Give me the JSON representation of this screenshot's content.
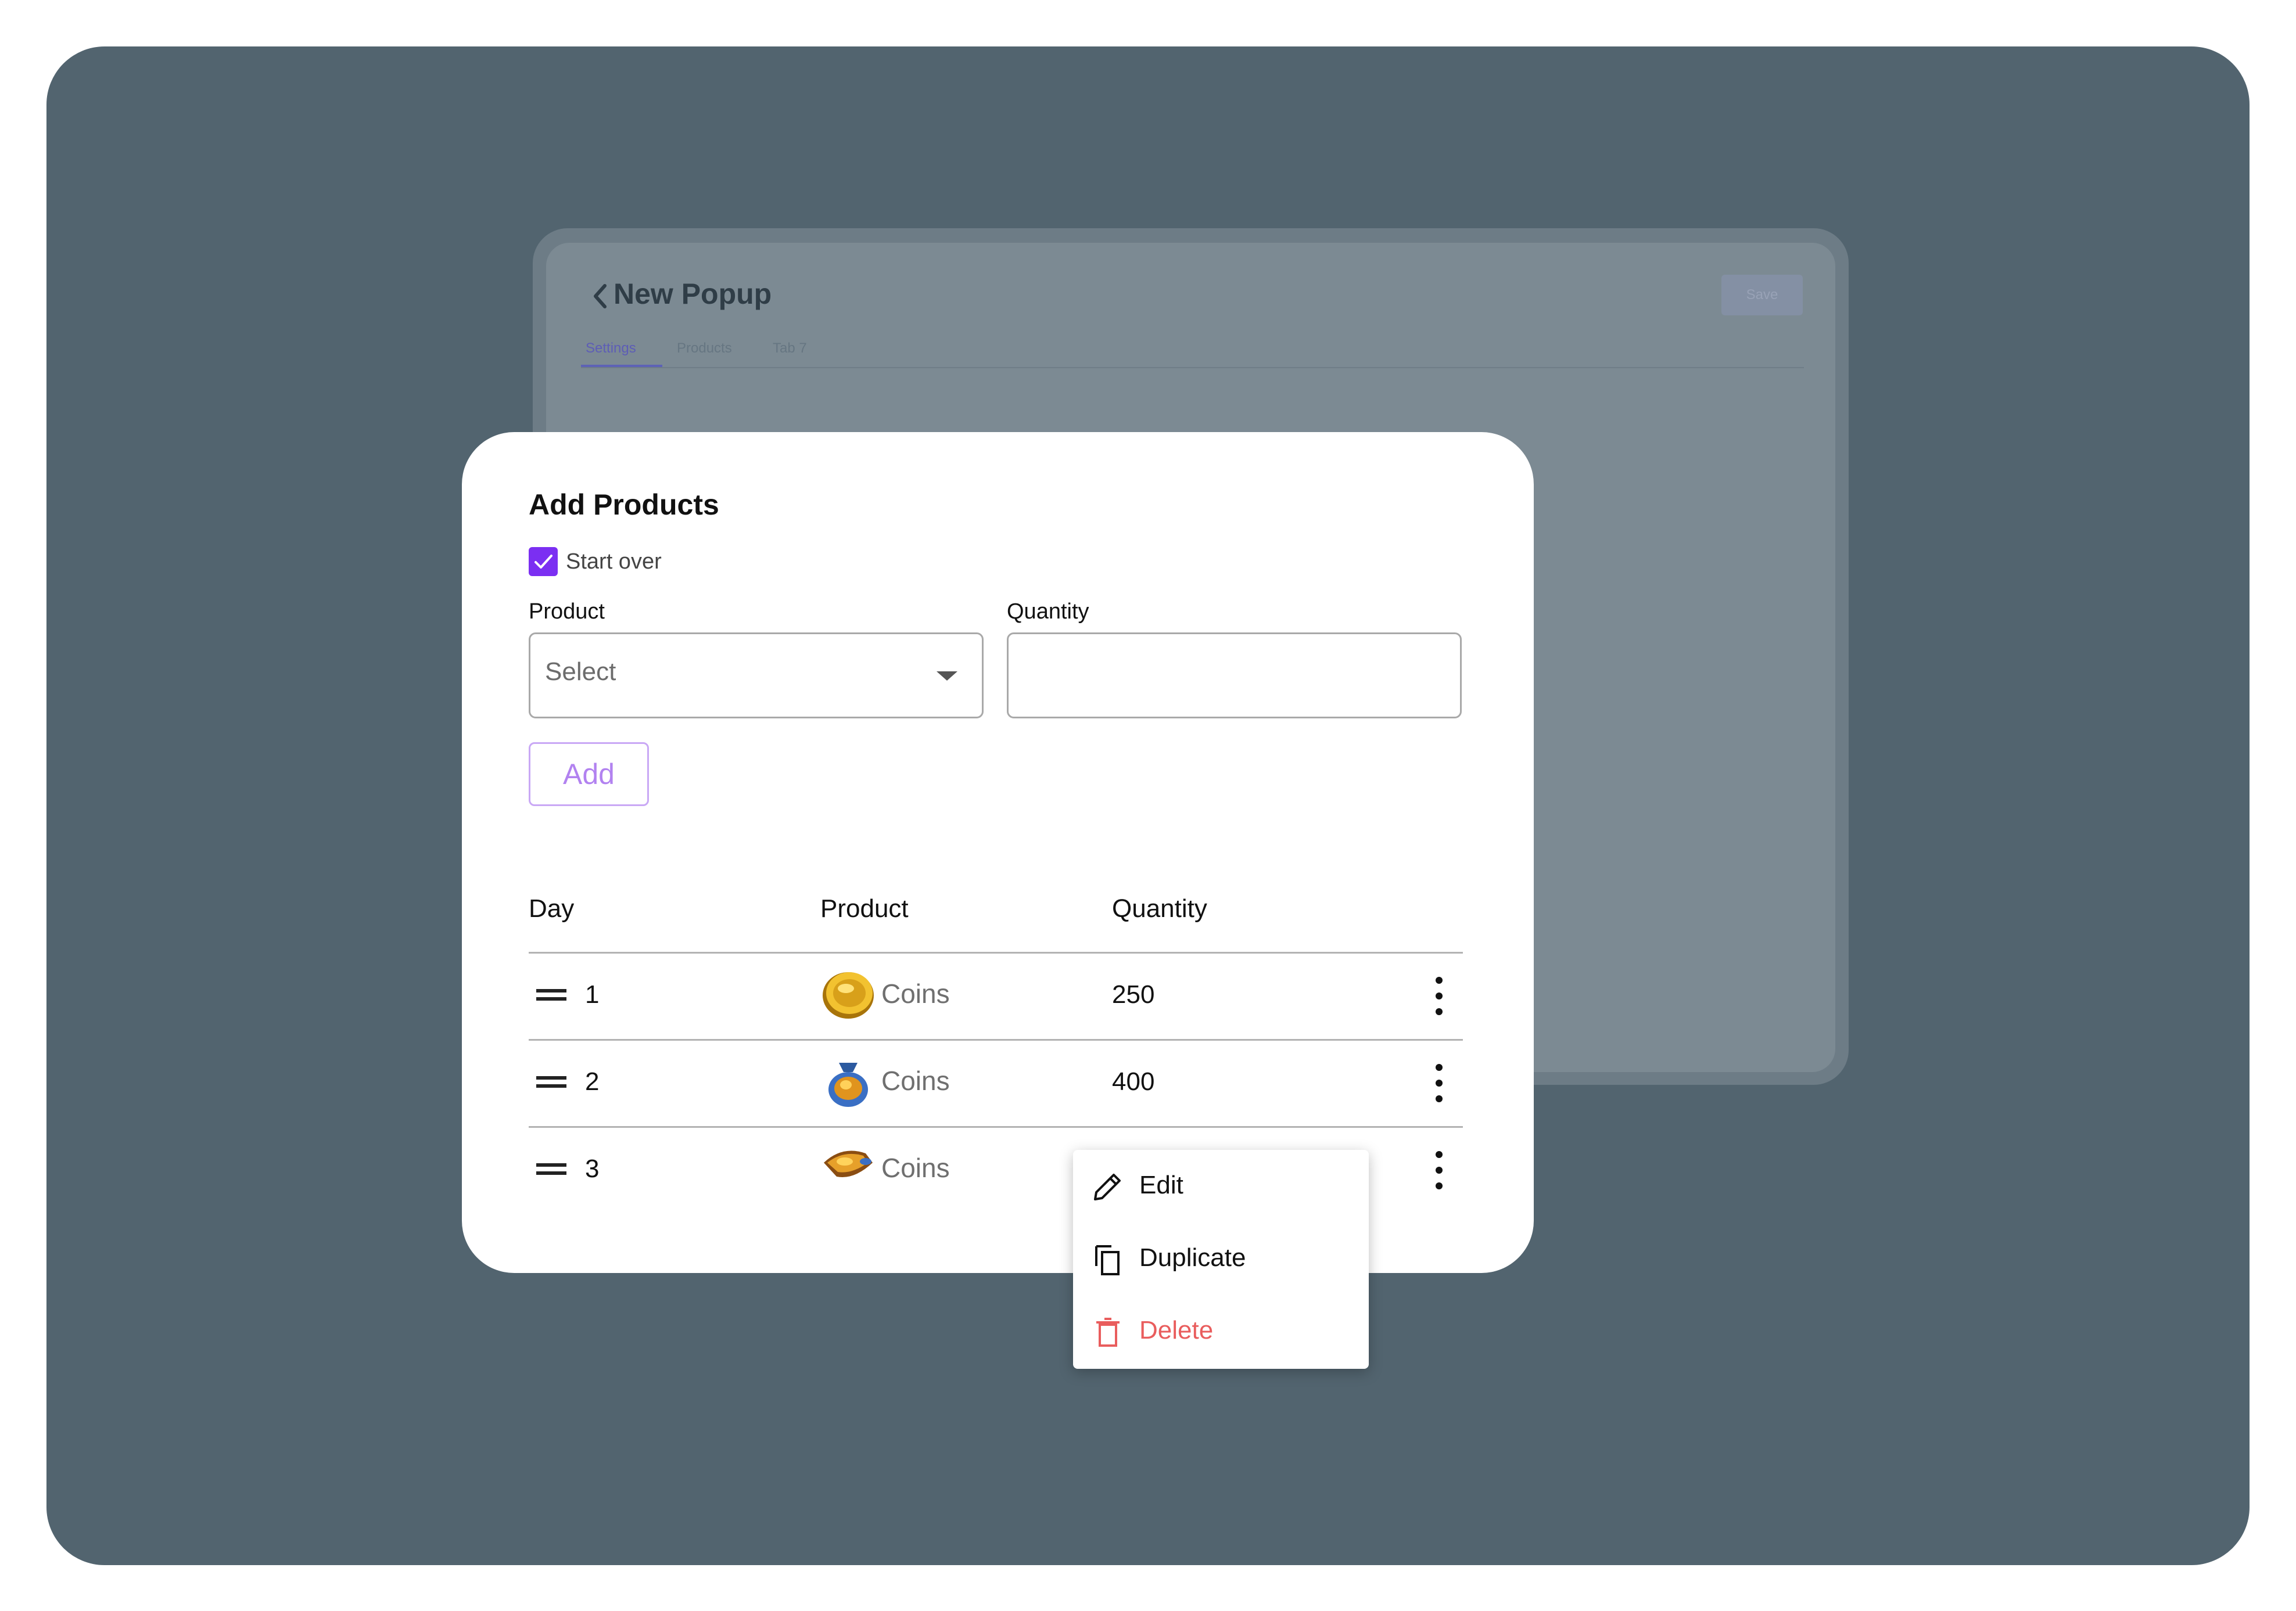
{
  "background_window": {
    "title": "New Popup",
    "save_label": "Save",
    "tabs": [
      {
        "label": "Settings",
        "active": true
      },
      {
        "label": "Products",
        "active": false
      },
      {
        "label": "Tab 7",
        "active": false
      }
    ]
  },
  "modal": {
    "title": "Add Products",
    "start_over": {
      "label": "Start over",
      "checked": true
    },
    "product_field": {
      "label": "Product",
      "placeholder": "Select"
    },
    "quantity_field": {
      "label": "Quantity",
      "value": ""
    },
    "add_label": "Add",
    "table": {
      "headers": [
        "Day",
        "Product",
        "Quantity"
      ],
      "rows": [
        {
          "day": "1",
          "product": "Coins",
          "product_icon": "gold-coin-icon",
          "quantity": "250"
        },
        {
          "day": "2",
          "product": "Coins",
          "product_icon": "coin-bag-icon",
          "quantity": "400"
        },
        {
          "day": "3",
          "product": "Coins",
          "product_icon": "coin-pile-icon",
          "quantity": ""
        }
      ]
    }
  },
  "context_menu": {
    "items": [
      {
        "label": "Edit",
        "icon": "pencil-icon"
      },
      {
        "label": "Duplicate",
        "icon": "copy-icon"
      },
      {
        "label": "Delete",
        "icon": "trash-icon",
        "color": "#e95d5d"
      }
    ]
  },
  "colors": {
    "accent": "#7b2ff2",
    "backdrop": "#52646f",
    "danger": "#e95d5d"
  }
}
